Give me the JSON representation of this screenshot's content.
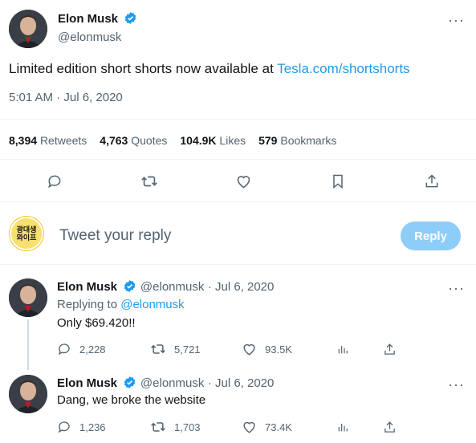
{
  "main_tweet": {
    "author_name": "Elon Musk",
    "author_handle": "@elonmusk",
    "text_prefix": "Limited edition short shorts now available at ",
    "link_text": "Tesla.com/shortshorts",
    "timestamp": "5:01 AM · Jul 6, 2020",
    "stats": [
      {
        "value": "8,394",
        "label": "Retweets"
      },
      {
        "value": "4,763",
        "label": "Quotes"
      },
      {
        "value": "104.9K",
        "label": "Likes"
      },
      {
        "value": "579",
        "label": "Bookmarks"
      }
    ],
    "more_label": "···"
  },
  "composer": {
    "avatar_text_line1": "광대생",
    "avatar_text_line2": "와이프",
    "placeholder": "Tweet your reply",
    "reply_label": "Reply"
  },
  "replies": [
    {
      "author_name": "Elon Musk",
      "author_handle": "@elonmusk",
      "date": "· Jul 6, 2020",
      "replying_prefix": "Replying to ",
      "replying_handle": "@elonmusk",
      "text": "Only $69.420!!",
      "replies": "2,228",
      "retweets": "5,721",
      "likes": "93.5K",
      "more_label": "···"
    },
    {
      "author_name": "Elon Musk",
      "author_handle": "@elonmusk",
      "date": "· Jul 6, 2020",
      "text": "Dang, we broke the website",
      "replies": "1,236",
      "retweets": "1,703",
      "likes": "73.4K",
      "more_label": "···"
    }
  ],
  "colors": {
    "accent": "#1d9bf0",
    "muted": "#536471",
    "reply_button_disabled": "#8ecdf8",
    "verified": "#1d9bf0"
  },
  "icons": {
    "reply": "reply-icon",
    "retweet": "retweet-icon",
    "like": "heart-icon",
    "bookmark": "bookmark-icon",
    "share": "share-icon",
    "analytics": "analytics-icon",
    "verified": "verified-badge-icon",
    "more": "more-icon"
  }
}
